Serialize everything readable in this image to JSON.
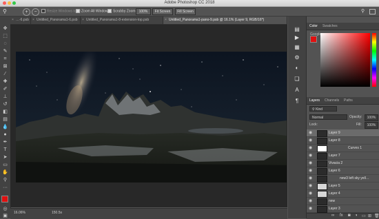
{
  "window": {
    "title": "Adobe Photoshop CC 2018"
  },
  "options_bar": {
    "resize_windows_label": "Resize Windows to Fit",
    "zoom_all_label": "Zoom All Windows",
    "scrubby_zoom_label": "Scrubby Zoom",
    "zoom_level": "100%",
    "fit_screen_label": "Fit Screen",
    "fill_screen_label": "Fill Screen"
  },
  "tabs": [
    {
      "label": "…-6.psb",
      "active": false
    },
    {
      "label": "Untitled_Panorama1-6.psb",
      "active": false
    },
    {
      "label": "Untitled_Panorama1-8-extension-top.psb",
      "active": false
    },
    {
      "label": "Untitled_Panorama1-pano-9.psb @ 16.1% (Layer 9, RGB/16*)",
      "active": true
    }
  ],
  "status": {
    "zoom": "16.06%",
    "doc_size": "150.5s"
  },
  "color_panel": {
    "tabs": [
      "Color",
      "Swatches"
    ],
    "picker_label": "Google"
  },
  "layers_panel": {
    "tabs": [
      "Layers",
      "Channels",
      "Paths"
    ],
    "kind_label": "Kind",
    "blend_mode": "Normal",
    "opacity_label": "Opacity:",
    "opacity_value": "100%",
    "lock_label": "Lock:",
    "fill_label": "Fill:",
    "fill_value": "100%",
    "layers": [
      {
        "name": "Layer 9",
        "selected": true
      },
      {
        "name": "Layer 8",
        "selected": false
      },
      {
        "name": "Curves 1",
        "selected": false
      },
      {
        "name": "Layer 7",
        "selected": false
      },
      {
        "name": "Vivacia 2",
        "selected": false
      },
      {
        "name": "Layer 6",
        "selected": false
      },
      {
        "name": "new3 left sky yell…",
        "selected": false
      },
      {
        "name": "Layer 5",
        "selected": false
      },
      {
        "name": "Layer 4",
        "selected": false
      },
      {
        "name": "new",
        "selected": false
      },
      {
        "name": "Layer 3",
        "selected": false
      }
    ]
  },
  "colors": {
    "foreground": "#e01010",
    "background": "#000000",
    "ui_dark": "#424242",
    "ui_mid": "#535353"
  }
}
